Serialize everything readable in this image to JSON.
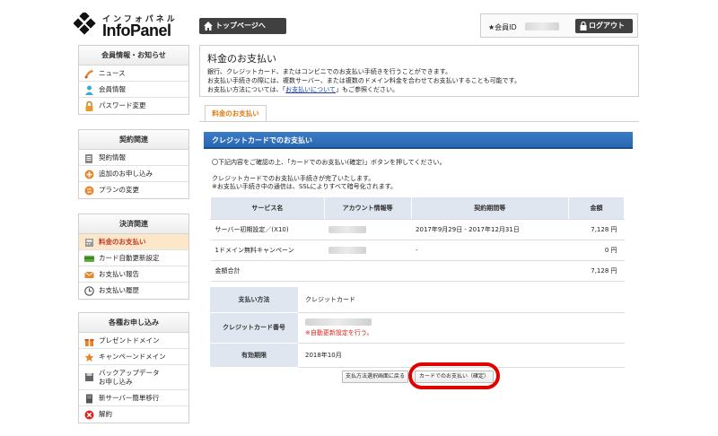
{
  "header": {
    "logo_kana": "インフォパネル",
    "logo_name": "InfoPanel",
    "top_page_button": "トップページへ",
    "member_label": "★会員ID",
    "logout_button": "ログアウト"
  },
  "sidebar": {
    "sections": [
      {
        "title": "会員情報・お知らせ",
        "items": [
          {
            "label": "ニュース",
            "icon": "news-icon"
          },
          {
            "label": "会員情報",
            "icon": "member-icon"
          },
          {
            "label": "パスワード変更",
            "icon": "lock-icon"
          }
        ]
      },
      {
        "title": "契約関連",
        "items": [
          {
            "label": "契約情報",
            "icon": "contract-icon"
          },
          {
            "label": "追加のお申し込み",
            "icon": "add-icon"
          },
          {
            "label": "プランの変更",
            "icon": "plan-change-icon"
          }
        ]
      },
      {
        "title": "決済関連",
        "items": [
          {
            "label": "料金のお支払い",
            "icon": "payment-icon",
            "active": true
          },
          {
            "label": "カード自動更新設定",
            "icon": "card-icon"
          },
          {
            "label": "お支払い報告",
            "icon": "report-icon"
          },
          {
            "label": "お支払い履歴",
            "icon": "clock-icon"
          }
        ]
      },
      {
        "title": "各種お申し込み",
        "items": [
          {
            "label": "プレゼントドメイン",
            "icon": "gift-icon"
          },
          {
            "label": "キャンペーンドメイン",
            "icon": "star-icon"
          },
          {
            "label": "バックアップデータ",
            "label2": "お申し込み",
            "icon": "backup-icon"
          },
          {
            "label": "新サーバー簡単移行",
            "icon": "server-icon"
          },
          {
            "label": "解約",
            "icon": "cancel-icon"
          }
        ]
      }
    ]
  },
  "intro": {
    "title": "料金のお支払い",
    "line1": "銀行、クレジットカード、またはコンビニでのお支払い手続きを行うことができます。",
    "line2": "お支払い手続きの際には、複数サーバー、または複数のドメイン料金を合わせてお支払いすることも可能です。",
    "line3_prefix": "お支払い方法については、「",
    "line3_link": "お支払いについて",
    "line3_suffix": "」もご参照ください。"
  },
  "tab_label": "料金のお支払い",
  "section_title": "クレジットカードでのお支払い",
  "messages": {
    "confirm": "〇下記内容をご確認の上、「カードでのお支払い(確定)」ボタンを押してください。",
    "done": "クレジットカードでのお支払い手続きが完了いたします。",
    "ssl": "※お支払い手続き中の通信は、SSLによりすべて暗号化されます。"
  },
  "service_table": {
    "headers": [
      "サービス名",
      "アカウント情報等",
      "契約期間等",
      "金額"
    ],
    "rows": [
      {
        "service": "サーバー初期設定／(X10)",
        "period": "2017年9月29日 - 2017年12月31日",
        "amount": "7,128 円"
      },
      {
        "service": "1ドメイン無料キャンペーン",
        "period": "-",
        "amount": "0 円"
      }
    ],
    "total_label": "金額合計",
    "total_amount": "7,128 円"
  },
  "payment_table": {
    "method_label": "支払い方法",
    "method_value": "クレジットカード",
    "card_label": "クレジットカード番号",
    "card_note": "※自動更新設定を行う。",
    "expiry_label": "有効期限",
    "expiry_value": "2018年10月"
  },
  "buttons": {
    "back": "支払方法選択画面に戻る",
    "confirm": "カードでのお支払い（確定）"
  },
  "colors": {
    "section_blue": "#2a67b2",
    "tab_orange": "#e07a10",
    "highlight_red": "#e00000",
    "active_bg": "#fde7c9"
  }
}
